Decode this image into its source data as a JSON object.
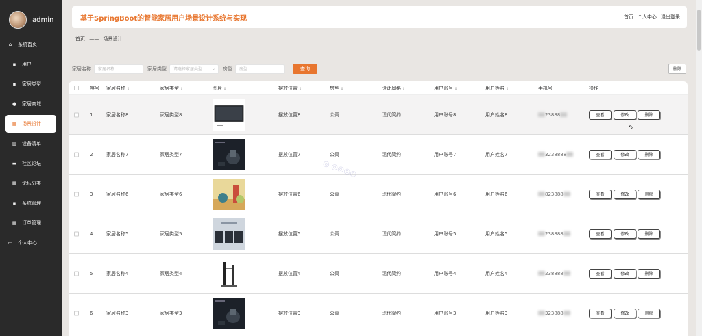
{
  "sidebar": {
    "username": "admin",
    "items": [
      {
        "label": "系统首页",
        "icon": "home-icon",
        "glyph": "⌂"
      },
      {
        "label": "用户",
        "icon": "user-icon",
        "glyph": "▪"
      },
      {
        "label": "家居类型",
        "icon": "category-icon",
        "glyph": "▪"
      },
      {
        "label": "家居商城",
        "icon": "location-icon",
        "glyph": "●"
      },
      {
        "label": "场景设计",
        "icon": "grid-icon",
        "glyph": "▦"
      },
      {
        "label": "设备清单",
        "icon": "chart-icon",
        "glyph": "▥"
      },
      {
        "label": "社区论坛",
        "icon": "chat-icon",
        "glyph": "▬"
      },
      {
        "label": "论坛分类",
        "icon": "grid-icon",
        "glyph": "▦"
      },
      {
        "label": "系统管理",
        "icon": "monitor-icon",
        "glyph": "▪"
      },
      {
        "label": "订单管理",
        "icon": "grid-icon",
        "glyph": "▦"
      },
      {
        "label": "个人中心",
        "icon": "profile-icon",
        "glyph": "▭"
      }
    ]
  },
  "header": {
    "title": "基于SpringBoot的智能家居用户场景设计系统与实现",
    "links": [
      "首页",
      "个人中心",
      "退出登录"
    ]
  },
  "breadcrumb": {
    "home": "首页",
    "sep": "——",
    "current": "场景设计"
  },
  "filters": {
    "name_label": "家居名称",
    "name_placeholder": "家居名称",
    "type_label": "家居类型",
    "type_placeholder": "请选择家居类型",
    "room_label": "房型",
    "room_placeholder": "房型",
    "query": "查询",
    "delete": "删除"
  },
  "table": {
    "columns": [
      "序号",
      "家居名称",
      "家居类型",
      "图片",
      "摆放位置",
      "房型",
      "设计风格",
      "用户账号",
      "用户姓名",
      "手机号",
      "操作"
    ],
    "rows": [
      {
        "no": "1",
        "name": "家居名称8",
        "type": "家居类型8",
        "pos": "摆放位置8",
        "room": "公寓",
        "style": "现代简约",
        "account": "用户账号8",
        "uname": "用户姓名8",
        "phone": "23888",
        "img": "tv"
      },
      {
        "no": "2",
        "name": "家居名称7",
        "type": "家居类型7",
        "pos": "摆放位置7",
        "room": "公寓",
        "style": "现代简约",
        "account": "用户账号7",
        "uname": "用户姓名7",
        "phone": "3238888",
        "img": "dark"
      },
      {
        "no": "3",
        "name": "家居名称6",
        "type": "家居类型6",
        "pos": "摆放位置6",
        "room": "公寓",
        "style": "现代简约",
        "account": "用户账号6",
        "uname": "用户姓名6",
        "phone": "823888",
        "img": "color"
      },
      {
        "no": "4",
        "name": "家居名称5",
        "type": "家居类型5",
        "pos": "摆放位置5",
        "room": "公寓",
        "style": "现代简约",
        "account": "用户账号5",
        "uname": "用户姓名5",
        "phone": "238888",
        "img": "light"
      },
      {
        "no": "5",
        "name": "家居名称4",
        "type": "家居类型4",
        "pos": "摆放位置4",
        "room": "公寓",
        "style": "现代简约",
        "account": "用户账号4",
        "uname": "用户姓名4",
        "phone": "238888",
        "img": "device"
      },
      {
        "no": "6",
        "name": "家居名称3",
        "type": "家居类型3",
        "pos": "摆放位置3",
        "room": "公寓",
        "style": "现代简约",
        "account": "用户账号3",
        "uname": "用户姓名3",
        "phone": "323888",
        "img": "dark"
      }
    ],
    "actions": [
      "查看",
      "修改",
      "删除"
    ]
  },
  "colors": {
    "accent": "#e8762f",
    "sidebar_bg": "#2a2a2a"
  }
}
